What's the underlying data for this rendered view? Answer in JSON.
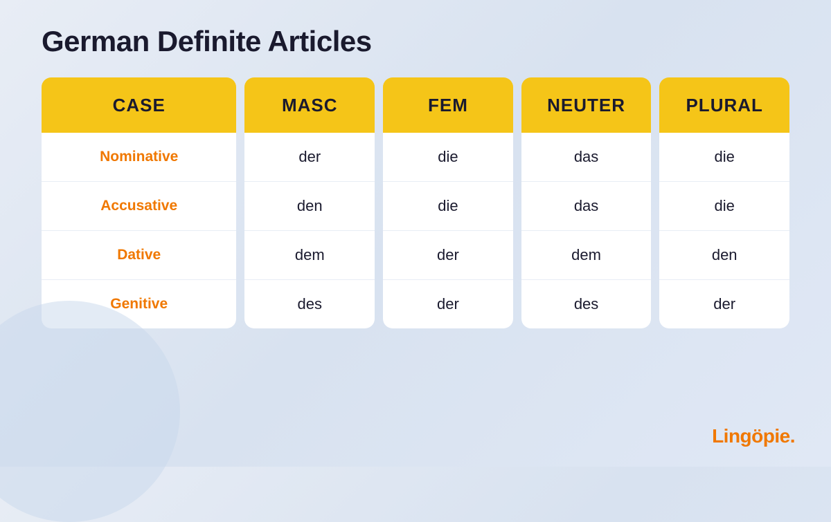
{
  "page": {
    "title": "German Definite Articles",
    "logo": "Lingöpie."
  },
  "columns": [
    {
      "id": "case",
      "header": "CASE",
      "cells": [
        "Nominative",
        "Accusative",
        "Dative",
        "Genitive"
      ]
    },
    {
      "id": "masc",
      "header": "MASC",
      "cells": [
        "der",
        "den",
        "dem",
        "des"
      ]
    },
    {
      "id": "fem",
      "header": "FEM",
      "cells": [
        "die",
        "die",
        "der",
        "der"
      ]
    },
    {
      "id": "neuter",
      "header": "NEUTER",
      "cells": [
        "das",
        "das",
        "dem",
        "des"
      ]
    },
    {
      "id": "plural",
      "header": "PLURAL",
      "cells": [
        "die",
        "die",
        "den",
        "der"
      ]
    }
  ]
}
